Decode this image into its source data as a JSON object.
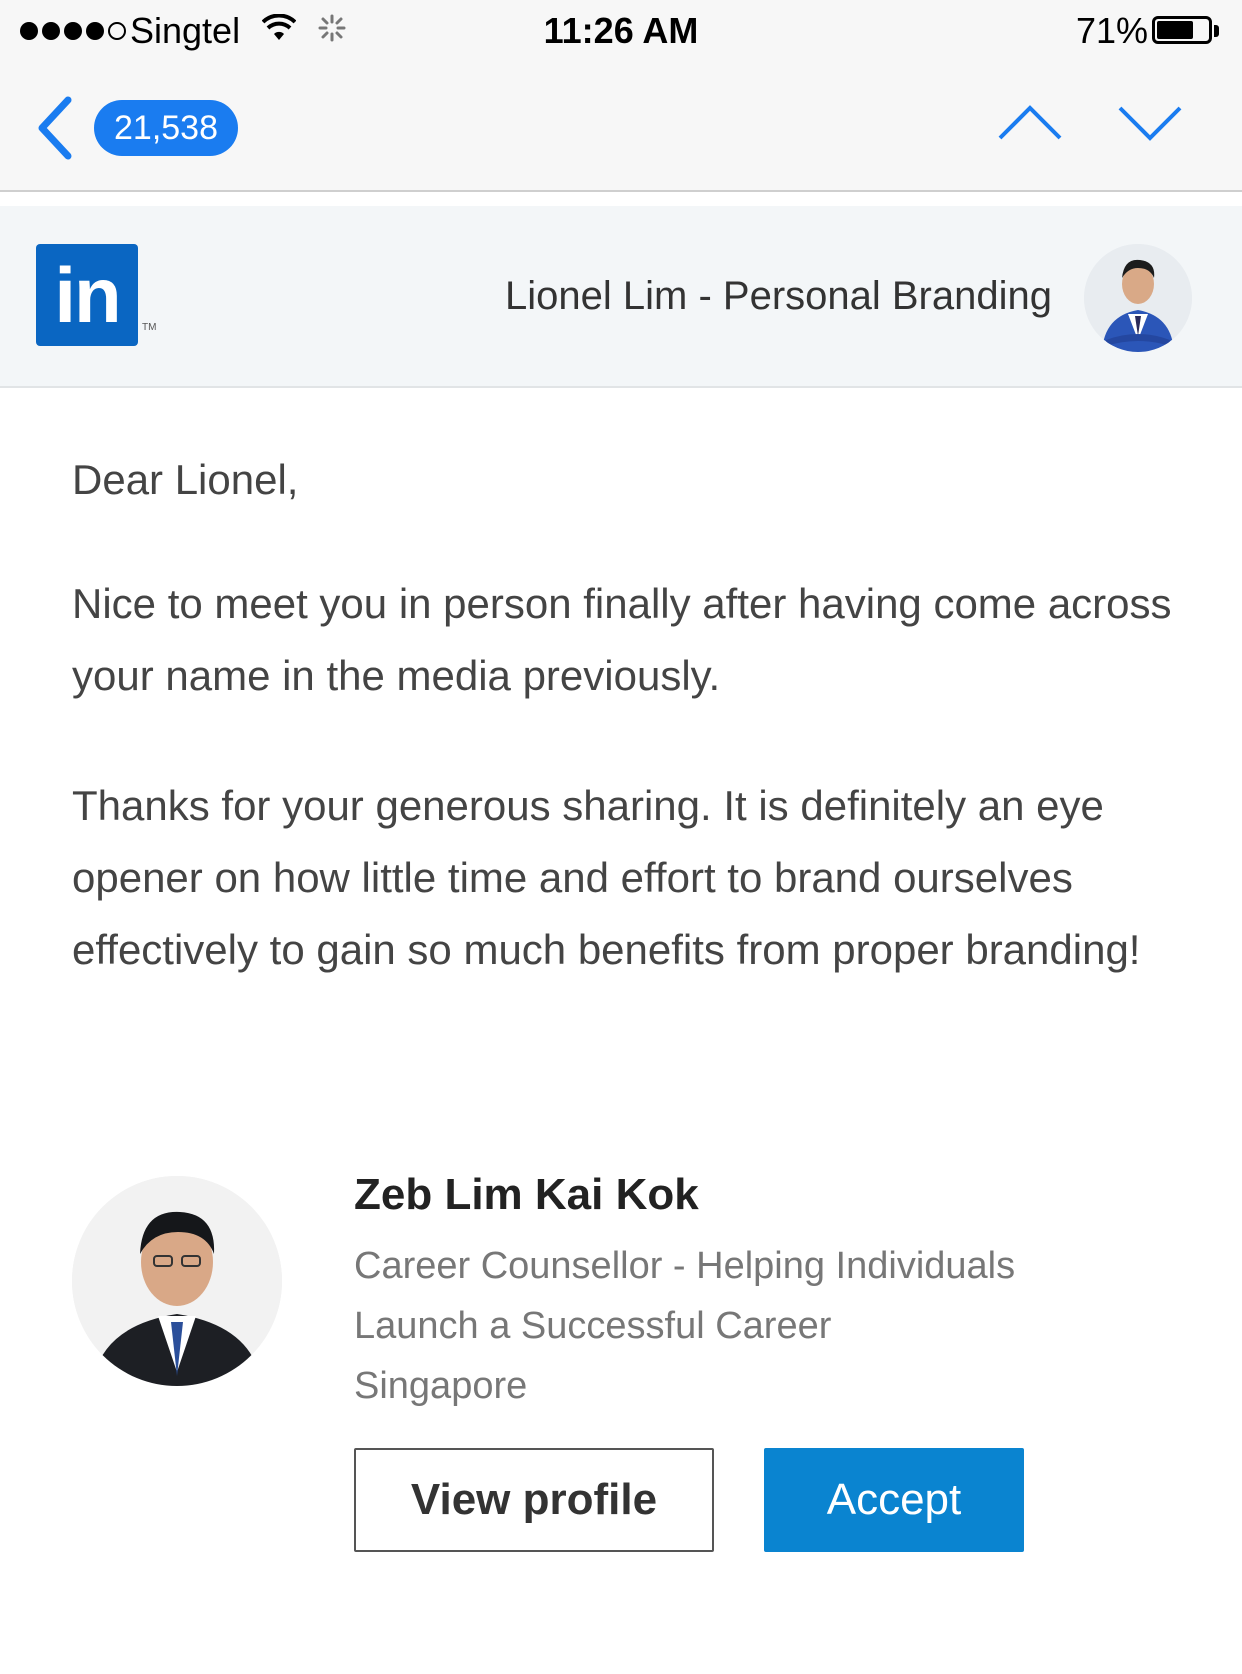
{
  "status_bar": {
    "carrier": "Singtel",
    "time": "11:26 AM",
    "battery": "71%",
    "battery_level": 0.71
  },
  "nav": {
    "unread_count": "21,538",
    "icons": [
      "back-chevron-icon",
      "chevron-up-icon",
      "chevron-down-icon"
    ]
  },
  "header": {
    "logo_text": "in",
    "logo_tm": "TM",
    "sender": "Lionel Lim - Personal Branding"
  },
  "message": {
    "greeting": "Dear Lionel,",
    "paragraph1": "Nice to meet you in person finally after having come across your name in the media previously.",
    "paragraph2": "Thanks for your generous sharing. It is definitely an eye opener on how little time and effort to brand ourselves effectively to gain so much benefits from proper branding!"
  },
  "invitation": {
    "name": "Zeb Lim Kai Kok",
    "headline": "Career Counsellor - Helping Individuals Launch a Successful Career",
    "location": "Singapore",
    "view_profile_label": "View profile",
    "accept_label": "Accept"
  },
  "colors": {
    "ios_blue": "#1a7cf0",
    "linkedin_blue": "#0a66c2",
    "accept_blue": "#0a84d0"
  }
}
